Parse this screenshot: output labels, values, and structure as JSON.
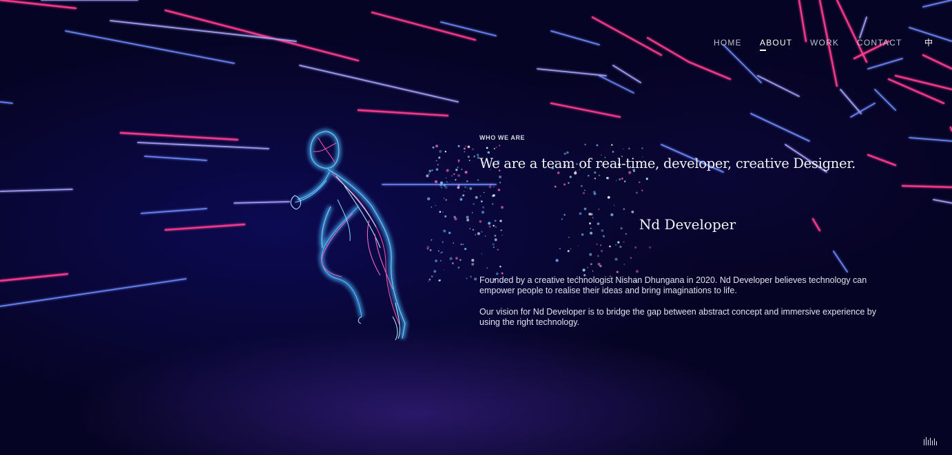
{
  "nav": {
    "items": [
      {
        "label": "HOME",
        "active": false
      },
      {
        "label": "ABOUT",
        "active": true
      },
      {
        "label": "WORK",
        "active": false
      },
      {
        "label": "CONTACT",
        "active": false
      }
    ],
    "language_toggle": "中"
  },
  "about": {
    "eyebrow": "WHO WE ARE",
    "headline": "We are a team of real-time, developer, creative Designer.",
    "brand": "Nd Developer",
    "paragraphs": [
      "Founded by a creative technologist Nishan Dhungana in 2020. Nd Developer believes technology can empower people to realise their ideas and bring imaginations to life.",
      "Our vision for Nd Developer is to bridge the gap between abstract concept and immersive experience by using the right technology."
    ]
  },
  "sound_toggle": {
    "icon": "sound-bars-icon"
  },
  "colors": {
    "background": "#05041f",
    "streak_pink": "#ff3d8f",
    "streak_blue": "#6f8cff",
    "streak_lavender": "#a9a6ff",
    "text": "#f2f2f7"
  }
}
